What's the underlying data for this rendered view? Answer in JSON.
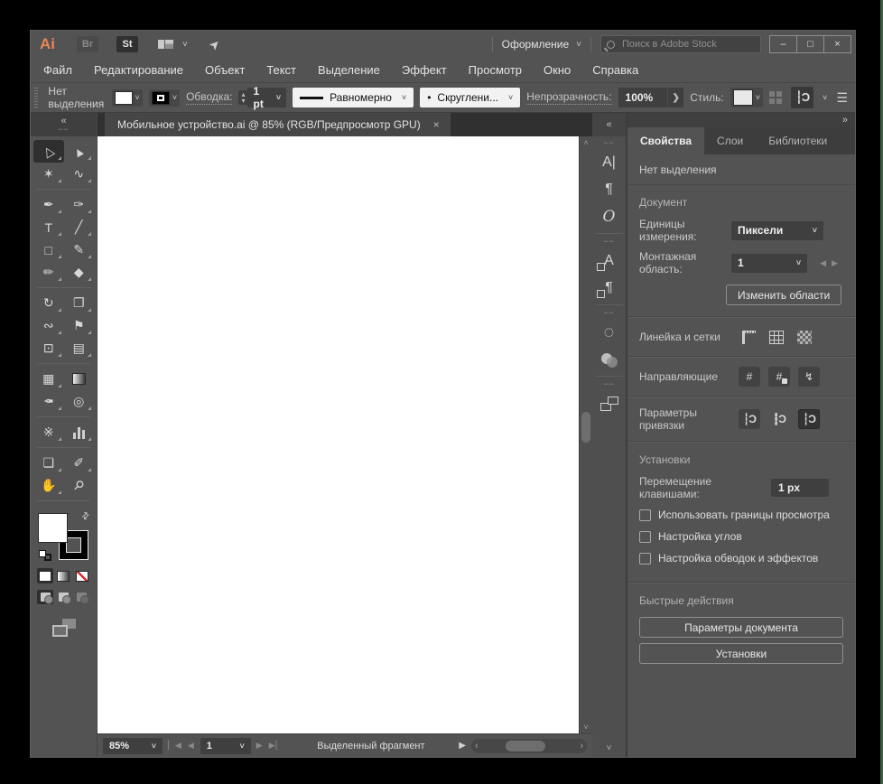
{
  "colors": {
    "chrome": "#535353",
    "field": "#3f3f3f",
    "accent_orange": "#e8855a",
    "canvas": "#ffffff",
    "edge_strip_green": "#3c5c45",
    "none_red": "#d22d2d"
  },
  "titlebar": {
    "logo": "Ai",
    "bridge_badge": "Br",
    "stock_badge": "St",
    "workspace_menu_label": "Оформление",
    "search_placeholder": "Поиск в Adobe Stock",
    "minimize_glyph": "–",
    "maximize_glyph": "□",
    "close_glyph": "×"
  },
  "menubar": {
    "items": [
      "Файл",
      "Редактирование",
      "Объект",
      "Текст",
      "Выделение",
      "Эффект",
      "Просмотр",
      "Окно",
      "Справка"
    ]
  },
  "controlbar": {
    "no_selection": "Нет выделения",
    "stroke_label": "Обводка:",
    "stroke_value": "1 pt",
    "profile_value": "Равномерно",
    "brush_dot": "•",
    "brush_value": "Скруглени...",
    "opacity_label": "Непрозрачность:",
    "opacity_value": "100%",
    "opacity_arrow": "❯",
    "style_label": "Стиль:"
  },
  "tabbar": {
    "document_title": "Мобильное устройство.ai @ 85% (RGB/Предпросмотр GPU)",
    "close_glyph": "×"
  },
  "icons": {
    "chevron_down": "˅",
    "chevron_up": "˄",
    "collapse_left": "«",
    "collapse_right": "»",
    "dots": "┉┉",
    "swap": "⇄",
    "menu": "☰",
    "play": "▶",
    "nav_first": "▏◀",
    "nav_prev": "◀",
    "nav_next": "▶",
    "nav_last": "▶▏",
    "scroll_left": "‹",
    "scroll_right": "›",
    "snap_point": "┆Ɔ",
    "snap_grid": "┇Ɔ",
    "snap_pixel": "┆Ɔ",
    "guides": "#",
    "smart_guides": "↯",
    "character": "A|",
    "paragraph": "¶",
    "opentype": "O",
    "char_styles": "A",
    "para_styles": "¶",
    "dashed_circle": "◌"
  },
  "tools": {
    "selection": "△",
    "direct_selection": "▲",
    "magic_wand": "✶",
    "lasso": "∿",
    "pen": "✒",
    "curvature": "✑",
    "type": "T",
    "line_segment": "╱",
    "rectangle": "□",
    "paintbrush": "✎",
    "shaper": "✏",
    "eraser": "◆",
    "rotate": "↻",
    "scale": "❐",
    "width": "∾",
    "puppet_warp": "⚑",
    "shape_builder": "⊡",
    "perspective_grid": "▤",
    "mesh": "▦",
    "eyedropper": "✒",
    "blend": "◎",
    "symbol_sprayer": "※",
    "artboard": "❏",
    "slice": "✐",
    "hand": "✋",
    "zoom": "⚲"
  },
  "panel": {
    "tabs": [
      {
        "label": "Свойства"
      },
      {
        "label": "Слои"
      },
      {
        "label": "Библиотеки"
      }
    ],
    "no_selection": "Нет выделения",
    "document": {
      "header": "Документ",
      "units_label": "Единицы измерения:",
      "units_value": "Пиксели",
      "artboard_label": "Монтажная область:",
      "artboard_value": "1",
      "edit_artboards_button": "Изменить области"
    },
    "rulers_label": "Линейка и сетки",
    "guides_label": "Направляющие",
    "snap_label": "Параметры привязки",
    "prefs": {
      "header": "Установки",
      "nudge_label": "Перемещение клавишами:",
      "nudge_value": "1 px",
      "checkboxes": [
        "Использовать границы просмотра",
        "Настройка углов",
        "Настройка обводок и эффектов"
      ]
    },
    "quick": {
      "header": "Быстрые действия",
      "buttons": [
        "Параметры документа",
        "Установки"
      ]
    }
  },
  "statusbar": {
    "zoom_value": "85%",
    "artboard_nav_value": "1",
    "status_text": "Выделенный фрагмент"
  }
}
